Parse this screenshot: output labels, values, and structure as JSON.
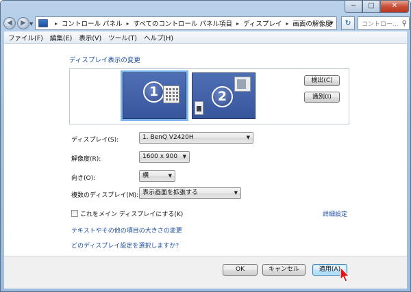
{
  "window": {
    "breadcrumbs": [
      "コントロール パネル",
      "すべてのコントロール パネル項目",
      "ディスプレイ",
      "画面の解像度"
    ],
    "search_placeholder": "コントロー...",
    "buttons": {
      "minimize": "−",
      "maximize": "□",
      "close": "✕"
    }
  },
  "menu": [
    "ファイル(F)",
    "編集(E)",
    "表示(V)",
    "ツール(T)",
    "ヘルプ(H)"
  ],
  "main": {
    "section_title": "ディスプレイ表示の変更",
    "monitors": [
      "1",
      "2"
    ],
    "detect_label": "検出(C)",
    "identify_label": "識別(I)",
    "display_label": "ディスプレイ(S):",
    "display_value": "1. BenQ V2420H",
    "resolution_label": "解像度(R):",
    "resolution_value": "1600 x 900",
    "orientation_label": "向き(O):",
    "orientation_value": "横",
    "multi_label": "複数のディスプレイ(M):",
    "multi_value": "表示画面を拡張する",
    "main_display_label": "これをメイン ディスプレイにする(K)",
    "main_display_checked": false,
    "advanced_link": "詳細設定",
    "link_text_size": "テキストやその他の項目の大きさの変更",
    "link_which_settings": "どのディスプレイ設定を選択しますか?"
  },
  "footer": {
    "ok": "OK",
    "cancel": "キャンセル",
    "apply": "適用(A)"
  }
}
